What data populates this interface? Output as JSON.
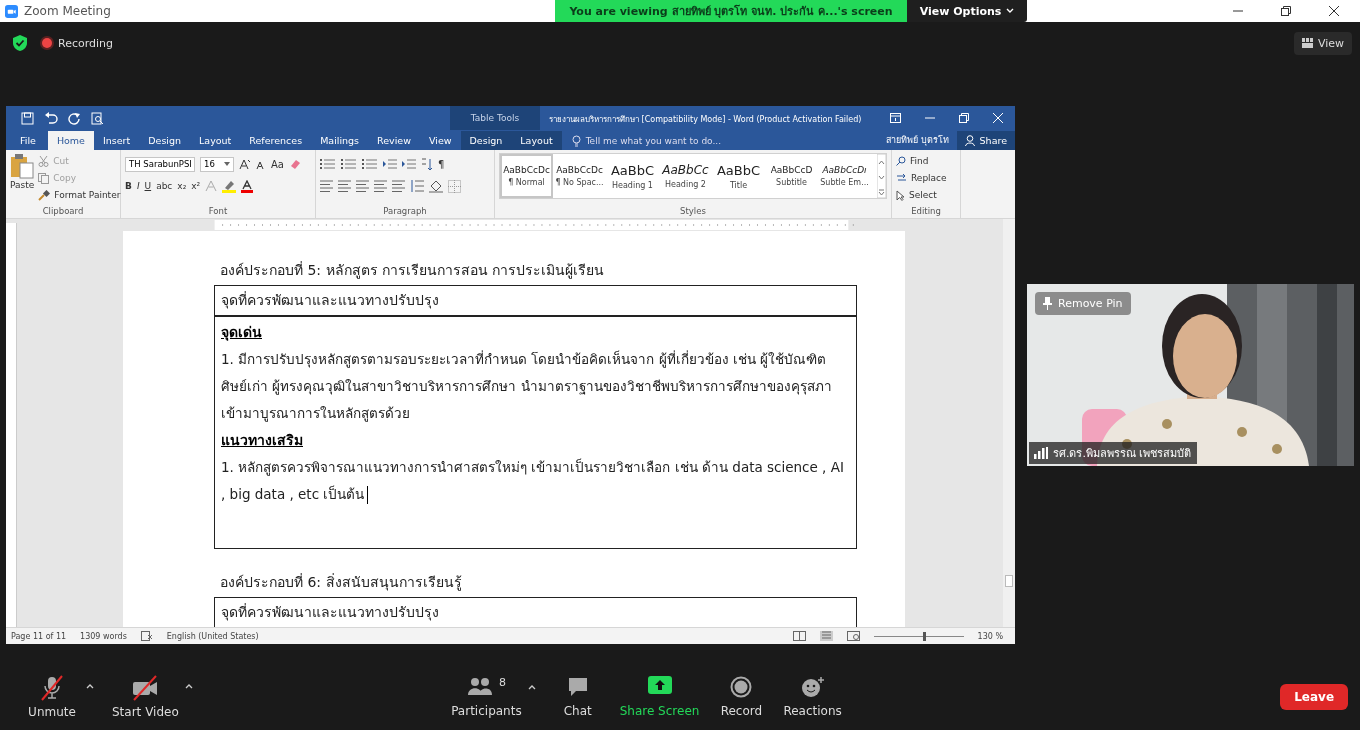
{
  "zoom_window": {
    "title": "Zoom Meeting",
    "banner": "You are viewing สายทิพย์ บุตรโท จนท. ประกัน ค...'s screen",
    "view_options": "View Options",
    "recording": "Recording",
    "view": "View"
  },
  "word": {
    "title": "รายงานผลบริหารการศึกษา [Compatibility Mode] - Word (Product Activation Failed)",
    "table_tools": "Table Tools",
    "tell_me": "Tell me what you want to do...",
    "user": "สายทิพย์ บุตรโท",
    "share": "Share",
    "tabs": [
      {
        "label": "File",
        "selected": false
      },
      {
        "label": "Home",
        "selected": true
      },
      {
        "label": "Insert",
        "selected": false
      },
      {
        "label": "Design",
        "selected": false
      },
      {
        "label": "Layout",
        "selected": false
      },
      {
        "label": "References",
        "selected": false
      },
      {
        "label": "Mailings",
        "selected": false
      },
      {
        "label": "Review",
        "selected": false
      },
      {
        "label": "View",
        "selected": false
      }
    ],
    "table_tabs": [
      {
        "label": "Design",
        "selected": false
      },
      {
        "label": "Layout",
        "selected": false
      }
    ],
    "clipboard": {
      "paste": "Paste",
      "cut": {
        "label": "Cut",
        "disabled": true
      },
      "copy": {
        "label": "Copy",
        "disabled": true
      },
      "format_painter": "Format Painter",
      "group": "Clipboard"
    },
    "font": {
      "name": "TH SarabunPSI",
      "size": "16",
      "case": "Aa",
      "format_buttons": [
        "B",
        "I",
        "U",
        "abc",
        "x₂",
        "x²"
      ],
      "group": "Font"
    },
    "paragraph": {
      "group": "Paragraph",
      "pilcrow": "¶"
    },
    "styles": {
      "group": "Styles",
      "items": [
        {
          "preview": "AaBbCcDc",
          "name": "¶ Normal",
          "kind": "normal",
          "selected": true
        },
        {
          "preview": "AaBbCcDc",
          "name": "¶ No Spac...",
          "kind": "normal",
          "selected": false
        },
        {
          "preview": "AaBbC",
          "name": "Heading 1",
          "kind": "heading",
          "selected": false
        },
        {
          "preview": "AaBbCc",
          "name": "Heading 2",
          "kind": "heading-italic",
          "selected": false
        },
        {
          "preview": "AaBbC",
          "name": "Title",
          "kind": "heading",
          "selected": false
        },
        {
          "preview": "AaBbCcD",
          "name": "Subtitle",
          "kind": "normal",
          "selected": false
        },
        {
          "preview": "AaBbCcDı",
          "name": "Subtle Em...",
          "kind": "italic",
          "selected": false
        }
      ]
    },
    "editing": {
      "group": "Editing",
      "find": "Find",
      "replace": "Replace",
      "select": "Select"
    },
    "document": {
      "sections": [
        {
          "heading": "องค์ประกอบที่ 5: หลักสูตร การเรียนการสอน การประเมินผู้เรียน",
          "table_header": "จุดที่ควรพัฒนาและแนวทางปรับปรุง",
          "blocks": [
            {
              "kind": "subhead",
              "text": "จุดเด่น"
            },
            {
              "kind": "para",
              "text": "1. มีการปรับปรุงหลักสูตรตามรอบระยะเวลาที่กำหนด โดยนำข้อคิดเห็นจาก ผู้ที่เกี่ยวข้อง เช่น ผู้ใช้บัณฑิต ศิษย์เก่า ผู้ทรงคุณวุฒิในสาขาวิชาบริหารการศึกษา นำมาตราฐานของวิชาชีพบริหารการศึกษาของคุรุสภาเข้ามาบูรณาการในหลักสูตรด้วย"
            },
            {
              "kind": "subhead",
              "text": "แนวทางเสริม"
            },
            {
              "kind": "para",
              "text": "1. หลักสูตรควรพิจารณาแนวทางการนำศาสตรใหม่ๆ เข้ามาเป็นรายวิชาเลือก เช่น ด้าน data science , AI , big data , etc เป็นต้น"
            }
          ]
        },
        {
          "heading": "องค์ประกอบที่ 6: สิ่งสนับสนุนการเรียนรู้",
          "table_header": "จุดที่ควรพัฒนาและแนวทางปรับปรุง"
        }
      ]
    },
    "status": {
      "page": "Page 11 of 11",
      "words": "1309 words",
      "language": "English (United States)",
      "zoom": "130 %",
      "zoom_slider": {
        "level": 0.55
      }
    }
  },
  "video": {
    "remove_pin": "Remove Pin",
    "name": "รศ.ดร.พิมลพรรณ เพชรสมบัติ"
  },
  "toolbar": {
    "left": [
      {
        "kind": "mic",
        "label": "Unmute",
        "off": true
      },
      {
        "kind": "camera",
        "label": "Start Video",
        "off": true
      }
    ],
    "center": [
      {
        "kind": "participants",
        "label": "Participants",
        "count": "8"
      },
      {
        "kind": "chat",
        "label": "Chat"
      },
      {
        "kind": "share",
        "label": "Share Screen"
      },
      {
        "kind": "record",
        "label": "Record"
      },
      {
        "kind": "reactions",
        "label": "Reactions"
      }
    ],
    "leave": "Leave"
  }
}
